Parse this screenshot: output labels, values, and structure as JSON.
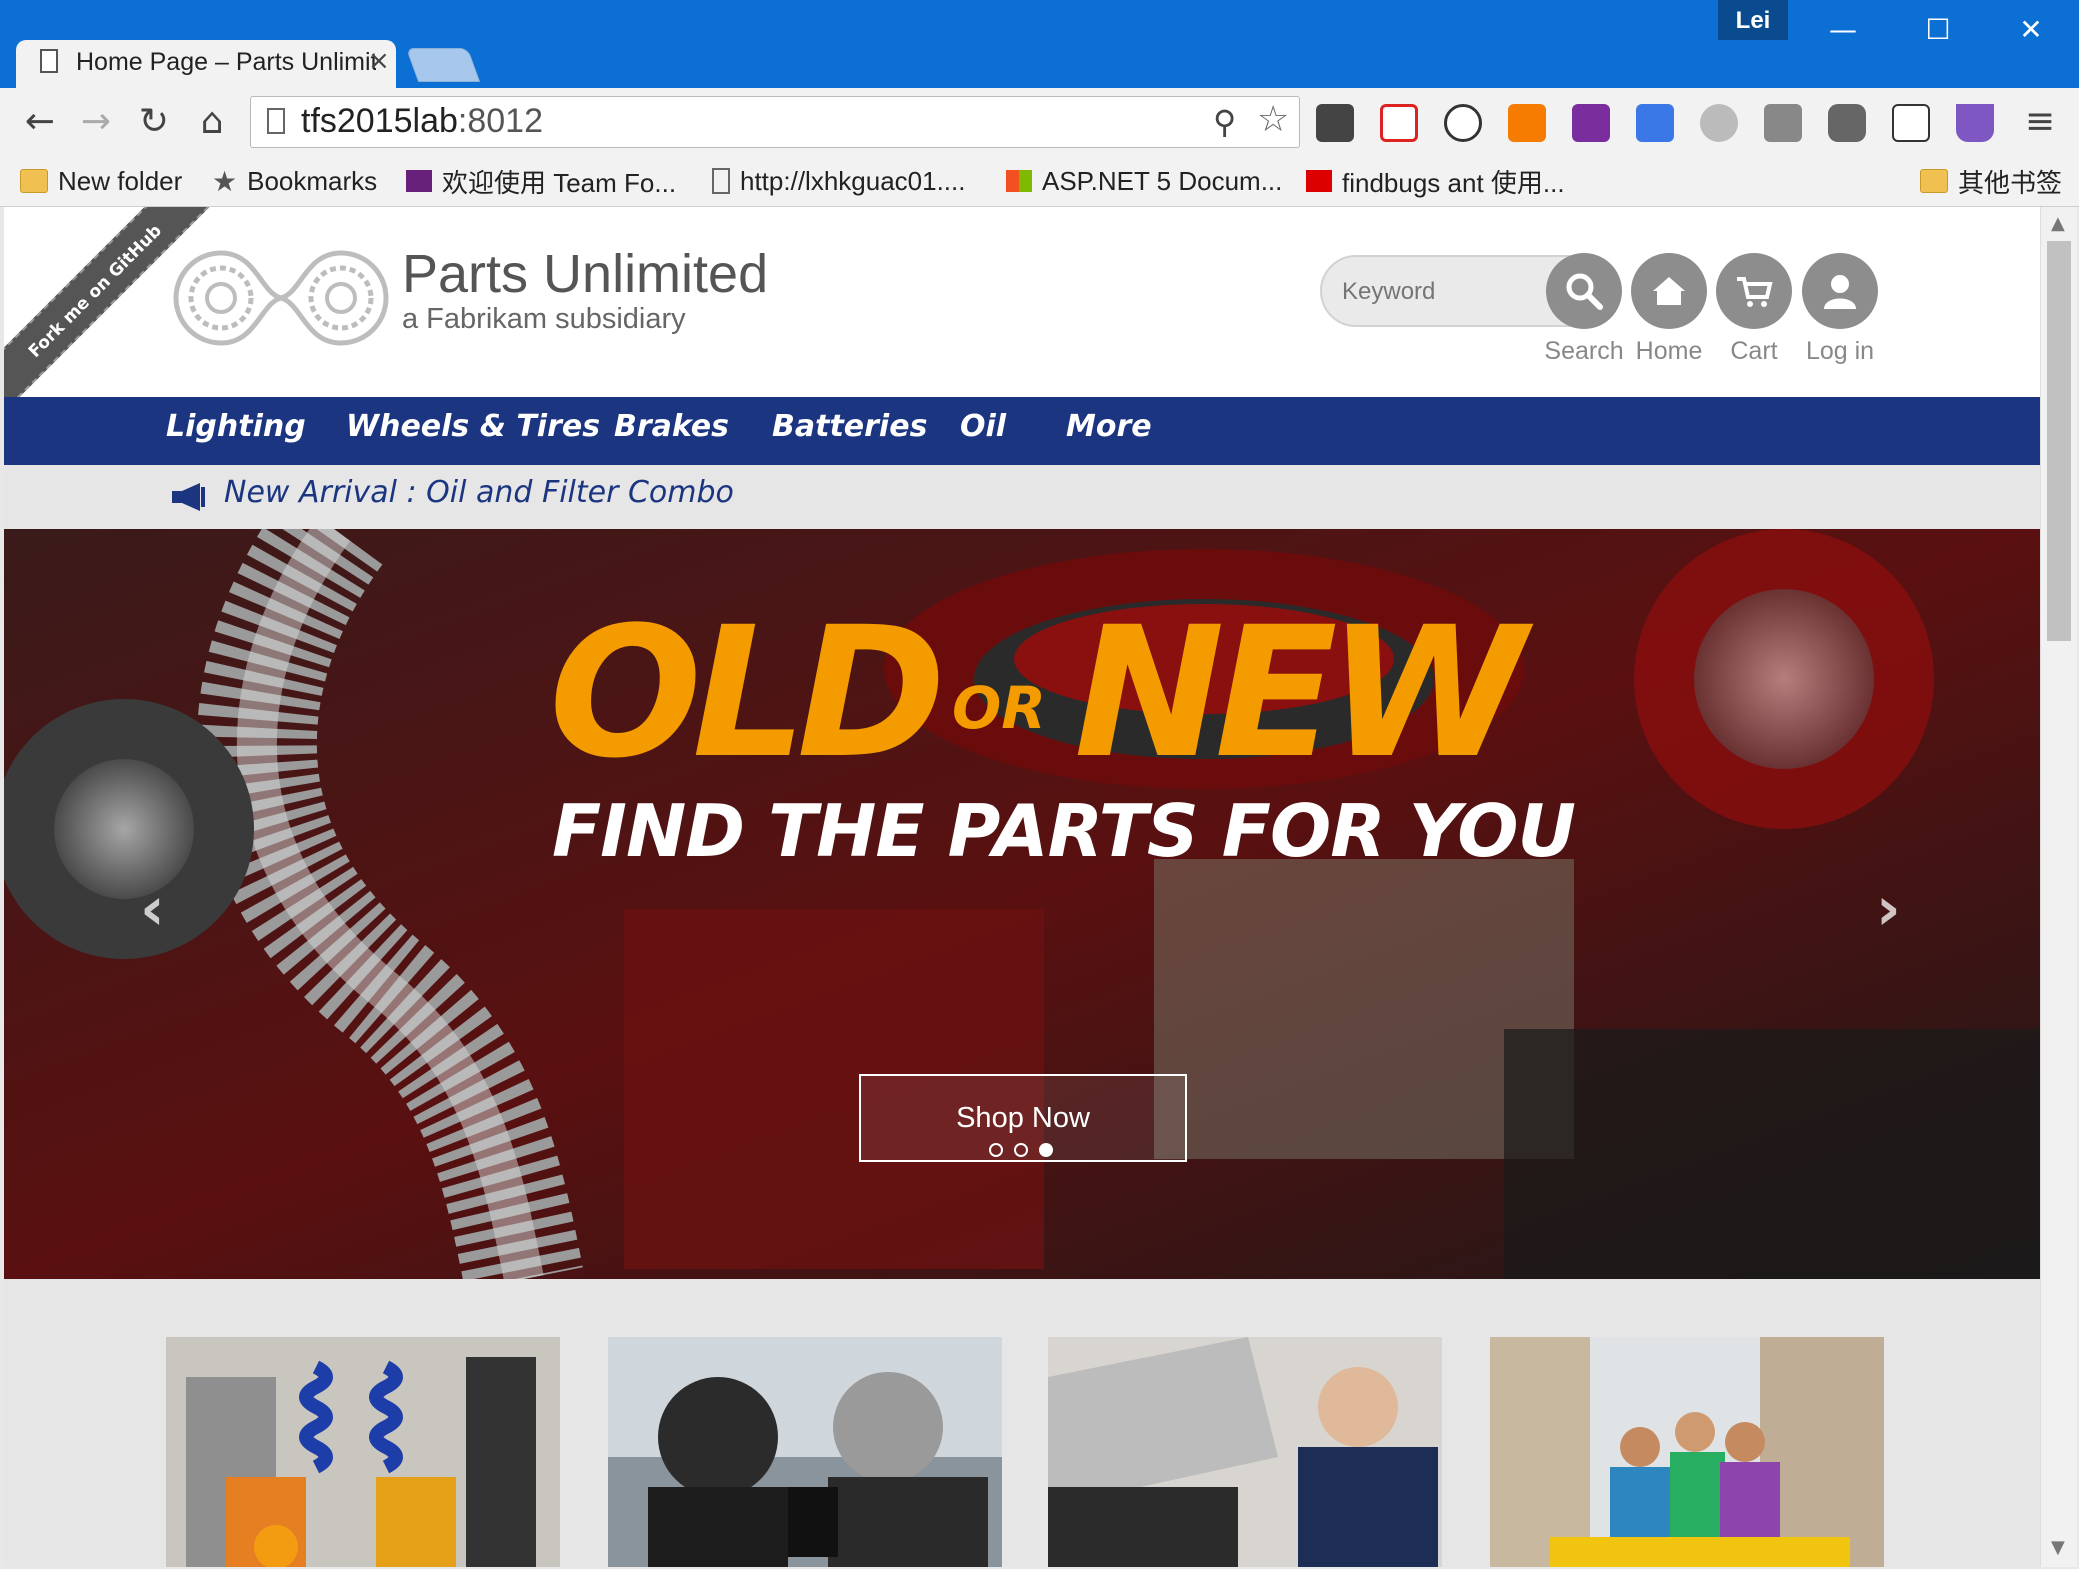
{
  "window": {
    "user": "Lei",
    "minimize": "—",
    "maximize": "☐",
    "close": "✕"
  },
  "tab": {
    "title": "Home Page – Parts Unlimited",
    "close": "×"
  },
  "toolbar": {
    "url_host": "tfs2015lab",
    "url_port": ":8012"
  },
  "bookmarks": [
    {
      "label": "New folder",
      "icon": "folder-icon"
    },
    {
      "label": "Bookmarks",
      "icon": "star-icon"
    },
    {
      "label": "欢迎使用 Team Fo...",
      "icon": "visual-studio-icon"
    },
    {
      "label": "http://lxhkguac01....",
      "icon": "page-icon"
    },
    {
      "label": "ASP.NET 5 Docum...",
      "icon": "windows-icon"
    },
    {
      "label": "findbugs ant 使用...",
      "icon": "findbugs-icon"
    },
    {
      "label": "其他书签",
      "icon": "folder-icon"
    }
  ],
  "ribbon": "Fork me on GitHub",
  "brand": {
    "title": "Parts Unlimited",
    "subtitle": "a Fabrikam subsidiary"
  },
  "search": {
    "placeholder": "Keyword"
  },
  "header_actions": [
    {
      "label": "Search",
      "icon": "search-icon"
    },
    {
      "label": "Home",
      "icon": "home-icon"
    },
    {
      "label": "Cart",
      "icon": "cart-icon"
    },
    {
      "label": "Log in",
      "icon": "user-icon"
    }
  ],
  "nav": [
    "Lighting",
    "Wheels & Tires",
    "Brakes",
    "Batteries",
    "Oil",
    "More"
  ],
  "announcement": "New Arrival : Oil and Filter Combo",
  "hero": {
    "headline_old": "OLD",
    "headline_or": "OR",
    "headline_new": "NEW",
    "subheadline": "FIND THE PARTS FOR YOU",
    "cta": "Shop Now",
    "slides": 3,
    "active_slide": 3
  },
  "colors": {
    "nav_bg": "#1b3581",
    "accent": "#f49b00",
    "titlebar": "#0b6fd4"
  }
}
